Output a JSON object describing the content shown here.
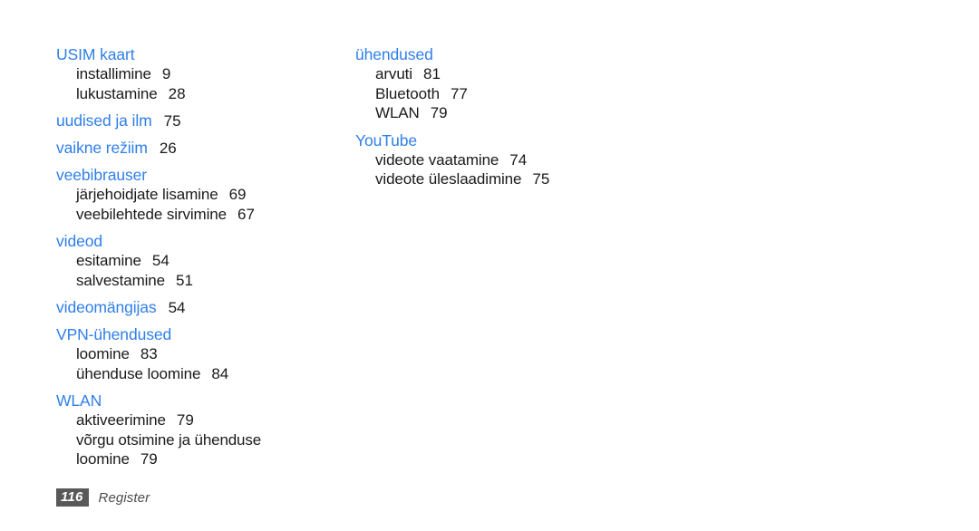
{
  "document": {
    "type": "index-page",
    "language": "et",
    "background_color": "#ffffff",
    "heading_color": "#2f7fe9",
    "text_color": "#1a1a1a"
  },
  "columns": {
    "left": [
      {
        "heading": "USIM kaart",
        "heading_page": "",
        "entries": [
          {
            "label": "installimine",
            "page": "9"
          },
          {
            "label": "lukustamine",
            "page": "28"
          }
        ]
      },
      {
        "heading": "uudised ja ilm",
        "heading_page": "75",
        "entries": []
      },
      {
        "heading": "vaikne režiim",
        "heading_page": "26",
        "entries": []
      },
      {
        "heading": "veebibrauser",
        "heading_page": "",
        "entries": [
          {
            "label": "järjehoidjate lisamine",
            "page": "69"
          },
          {
            "label": "veebilehtede sirvimine",
            "page": "67"
          }
        ]
      },
      {
        "heading": "videod",
        "heading_page": "",
        "entries": [
          {
            "label": "esitamine",
            "page": "54"
          },
          {
            "label": "salvestamine",
            "page": "51"
          }
        ]
      },
      {
        "heading": "videomängijas",
        "heading_page": "54",
        "entries": []
      },
      {
        "heading": "VPN-ühendused",
        "heading_page": "",
        "entries": [
          {
            "label": "loomine",
            "page": "83"
          },
          {
            "label": "ühenduse loomine",
            "page": "84"
          }
        ]
      },
      {
        "heading": "WLAN",
        "heading_page": "",
        "entries": [
          {
            "label": "aktiveerimine",
            "page": "79"
          },
          {
            "label": "võrgu otsimine ja ühenduse",
            "page": ""
          },
          {
            "label": "loomine",
            "page": "79"
          }
        ]
      }
    ],
    "right": [
      {
        "heading": "ühendused",
        "heading_page": "",
        "entries": [
          {
            "label": "arvuti",
            "page": "81"
          },
          {
            "label": "Bluetooth",
            "page": "77"
          },
          {
            "label": "WLAN",
            "page": "79"
          }
        ]
      },
      {
        "heading": "YouTube",
        "heading_page": "",
        "entries": [
          {
            "label": "videote vaatamine",
            "page": "74"
          },
          {
            "label": "videote üleslaadimine",
            "page": "75"
          }
        ]
      }
    ]
  },
  "footer": {
    "page_number": "116",
    "section_label": "Register"
  }
}
